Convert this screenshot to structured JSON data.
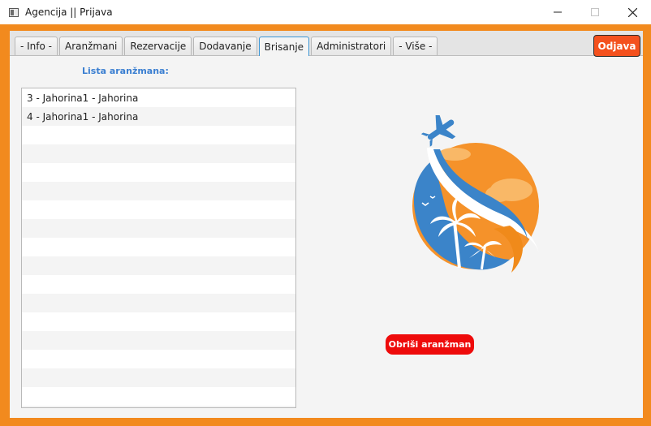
{
  "window": {
    "title": "Agencija || Prijava",
    "controls": {
      "minimize": "minimize-icon",
      "maximize": "maximize-icon",
      "close": "close-icon"
    }
  },
  "tabs": [
    {
      "label": "- Info -"
    },
    {
      "label": "Aranžmani"
    },
    {
      "label": "Rezervacije"
    },
    {
      "label": "Dodavanje"
    },
    {
      "label": "Brisanje",
      "active": true
    },
    {
      "label": "Administratori"
    },
    {
      "label": "- Više -"
    }
  ],
  "header": {
    "logout_label": "Odjava"
  },
  "main": {
    "list_title": "Lista aranžmana:",
    "items": [
      {
        "label": "3 - Jahorina1 - Jahorina"
      },
      {
        "label": "4 - Jahorina1 - Jahorina"
      }
    ],
    "delete_label": "Obriši aranžman"
  },
  "colors": {
    "frame": "#f28a1e",
    "logout": "#f4511e",
    "delete": "#ee0b0b",
    "accent_blue": "#3b7fd1"
  }
}
